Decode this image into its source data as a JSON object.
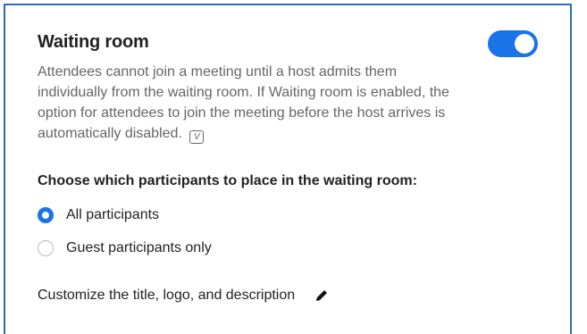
{
  "setting": {
    "title": "Waiting room",
    "enabled": true,
    "description": "Attendees cannot join a meeting until a host admits them individually from the waiting room. If Waiting room is enabled, the option for attendees to join the meeting before the host arrives is automatically disabled.",
    "info_icon": "V"
  },
  "participants": {
    "heading": "Choose which participants to place in the waiting room:",
    "options": [
      {
        "label": "All participants",
        "selected": true
      },
      {
        "label": "Guest participants only",
        "selected": false
      }
    ]
  },
  "customize": {
    "label": "Customize the title, logo, and description",
    "icon": "pencil-icon"
  },
  "colors": {
    "accent": "#1a73e8",
    "border": "#2e6db4"
  }
}
